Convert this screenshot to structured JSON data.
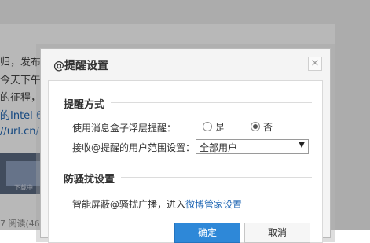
{
  "background": {
    "lines": [
      {
        "text": "归，发布"
      },
      {
        "text": "今天下午"
      },
      {
        "text": "的征程，"
      },
      {
        "text": "的Intel 6"
      },
      {
        "text": "//url.cn/"
      }
    ],
    "thumbnail_caption": "下载中",
    "meta": "7 阅读(46"
  },
  "dialog": {
    "title": "@提醒设置",
    "close_label": "×",
    "section1": {
      "heading": "提醒方式",
      "row1_label": "使用消息盒子浮层提醒：",
      "radio_yes": "是",
      "radio_no": "否",
      "selected": "否",
      "row2_label": "接收@提醒的用户范围设置：",
      "scope_value": "全部用户"
    },
    "section2": {
      "heading": "防骚扰设置",
      "text_prefix": "智能屏蔽@骚扰广播，进入",
      "link": "微博管家设置"
    },
    "buttons": {
      "confirm": "确定",
      "cancel": "取消"
    }
  }
}
